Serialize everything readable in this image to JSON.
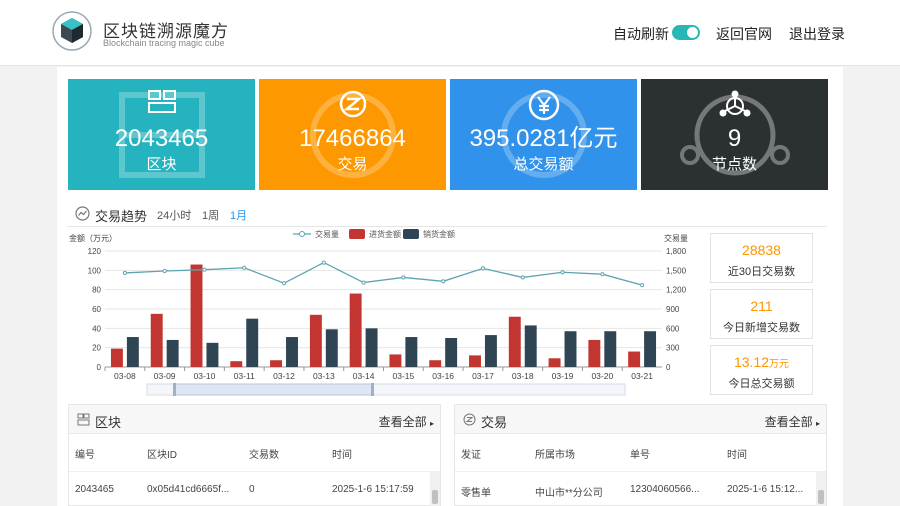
{
  "header": {
    "brand_title": "区块链溯源魔方",
    "brand_sub": "Blockchain tracing magic cube",
    "auto_refresh_label": "自动刷新",
    "auto_refresh_on": true,
    "back_label": "返回官网",
    "logout_label": "退出登录"
  },
  "stats": [
    {
      "value": "2043465",
      "label": "区块",
      "color": "#26b3c0"
    },
    {
      "value": "17466864",
      "label": "交易",
      "color": "#fd9800"
    },
    {
      "value": "395.0281亿元",
      "label": "总交易额",
      "color": "#3092ea"
    },
    {
      "value": "9",
      "label": "节点数",
      "color": "#2b3033"
    }
  ],
  "trend": {
    "title": "交易趋势",
    "tabs": [
      "24小时",
      "1周",
      "1月"
    ],
    "active_tab": 2
  },
  "side_stats": [
    {
      "value": "28838",
      "unit": "",
      "label": "近30日交易数"
    },
    {
      "value": "211",
      "unit": "",
      "label": "今日新增交易数"
    },
    {
      "value": "13.12",
      "unit": "万元",
      "label": "今日总交易额"
    }
  ],
  "chart_data": {
    "type": "bar",
    "categories": [
      "03-08",
      "03-09",
      "03-10",
      "03-11",
      "03-12",
      "03-13",
      "03-14",
      "03-15",
      "03-16",
      "03-17",
      "03-18",
      "03-19",
      "03-20",
      "03-21"
    ],
    "ylabel": "金额（万元）",
    "y2label": "交易量",
    "ylim": [
      0,
      120
    ],
    "y2lim": [
      0,
      1800
    ],
    "yticks": [
      0,
      20,
      40,
      60,
      80,
      100,
      120
    ],
    "y2ticks": [
      "0",
      "300",
      "600",
      "900",
      "1,200",
      "1,500",
      "1,800"
    ],
    "legend_position": "top",
    "series": [
      {
        "name": "交易量",
        "kind": "line",
        "axis": "right",
        "color": "#5ba5b0",
        "values": [
          1460,
          1490,
          1510,
          1540,
          1300,
          1620,
          1310,
          1390,
          1330,
          1530,
          1390,
          1470,
          1440,
          1270
        ]
      },
      {
        "name": "进货金额",
        "kind": "bar",
        "axis": "left",
        "color": "#c23531",
        "values": [
          19,
          55,
          106,
          6,
          7,
          54,
          76,
          13,
          7,
          12,
          52,
          9,
          28,
          16
        ]
      },
      {
        "name": "销货金额",
        "kind": "bar",
        "axis": "left",
        "color": "#2f4554",
        "values": [
          31,
          28,
          25,
          50,
          31,
          39,
          40,
          31,
          30,
          33,
          43,
          37,
          37,
          37
        ]
      }
    ]
  },
  "blocks_panel": {
    "title": "区块",
    "more": "查看全部",
    "columns": [
      "编号",
      "区块ID",
      "交易数",
      "时间"
    ],
    "rows": [
      [
        "2043465",
        "0x05d41cd6665f...",
        "0",
        "2025-1-6 15:17:59"
      ]
    ]
  },
  "tx_panel": {
    "title": "交易",
    "more": "查看全部",
    "columns": [
      "发证",
      "所属市场",
      "单号",
      "时间"
    ],
    "rows": [
      [
        "零售单",
        "中山市**分公司",
        "12304060566...",
        "2025-1-6 15:12..."
      ]
    ]
  }
}
